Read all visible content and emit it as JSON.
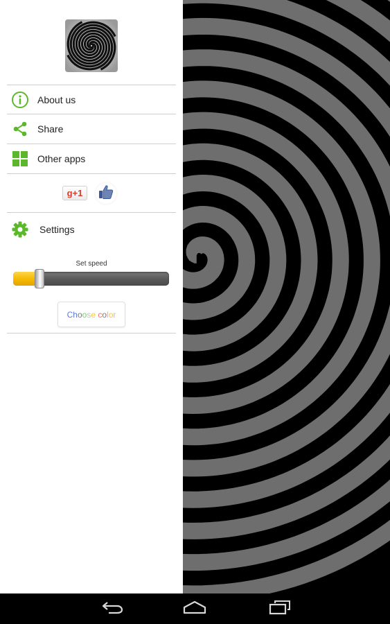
{
  "drawer": {
    "menu": [
      {
        "label": "About us",
        "icon": "info-icon"
      },
      {
        "label": "Share",
        "icon": "share-icon"
      },
      {
        "label": "Other apps",
        "icon": "grid-apps-icon"
      }
    ],
    "social": {
      "gplus_label": "g+1",
      "like_icon": "thumbs-up-icon"
    },
    "settings": {
      "label": "Settings",
      "icon": "gear-icon",
      "speed_label": "Set speed",
      "speed_value_fraction": 0.14,
      "color_button_label": "Choose color",
      "color_button_letter_colors": [
        "#5b7bd8",
        "#5b7bd8",
        "#7a7a7a",
        "#6fcf6f",
        "#bdbdbd",
        "#f2c94c",
        "#bdbdbd",
        "#e57373",
        "#7a7a7a",
        "#f2a0c0",
        "#f2c94c",
        "#c0c0c0"
      ]
    }
  },
  "colors": {
    "accent_green": "#5cb82a",
    "slider_fill": "#f5b800",
    "spiral_light": "#6e6e6e",
    "spiral_dark": "#000000"
  },
  "navbar": {
    "buttons": [
      {
        "name": "back",
        "icon": "back-arrow-icon"
      },
      {
        "name": "home",
        "icon": "home-icon"
      },
      {
        "name": "recents",
        "icon": "recent-apps-icon"
      }
    ]
  }
}
